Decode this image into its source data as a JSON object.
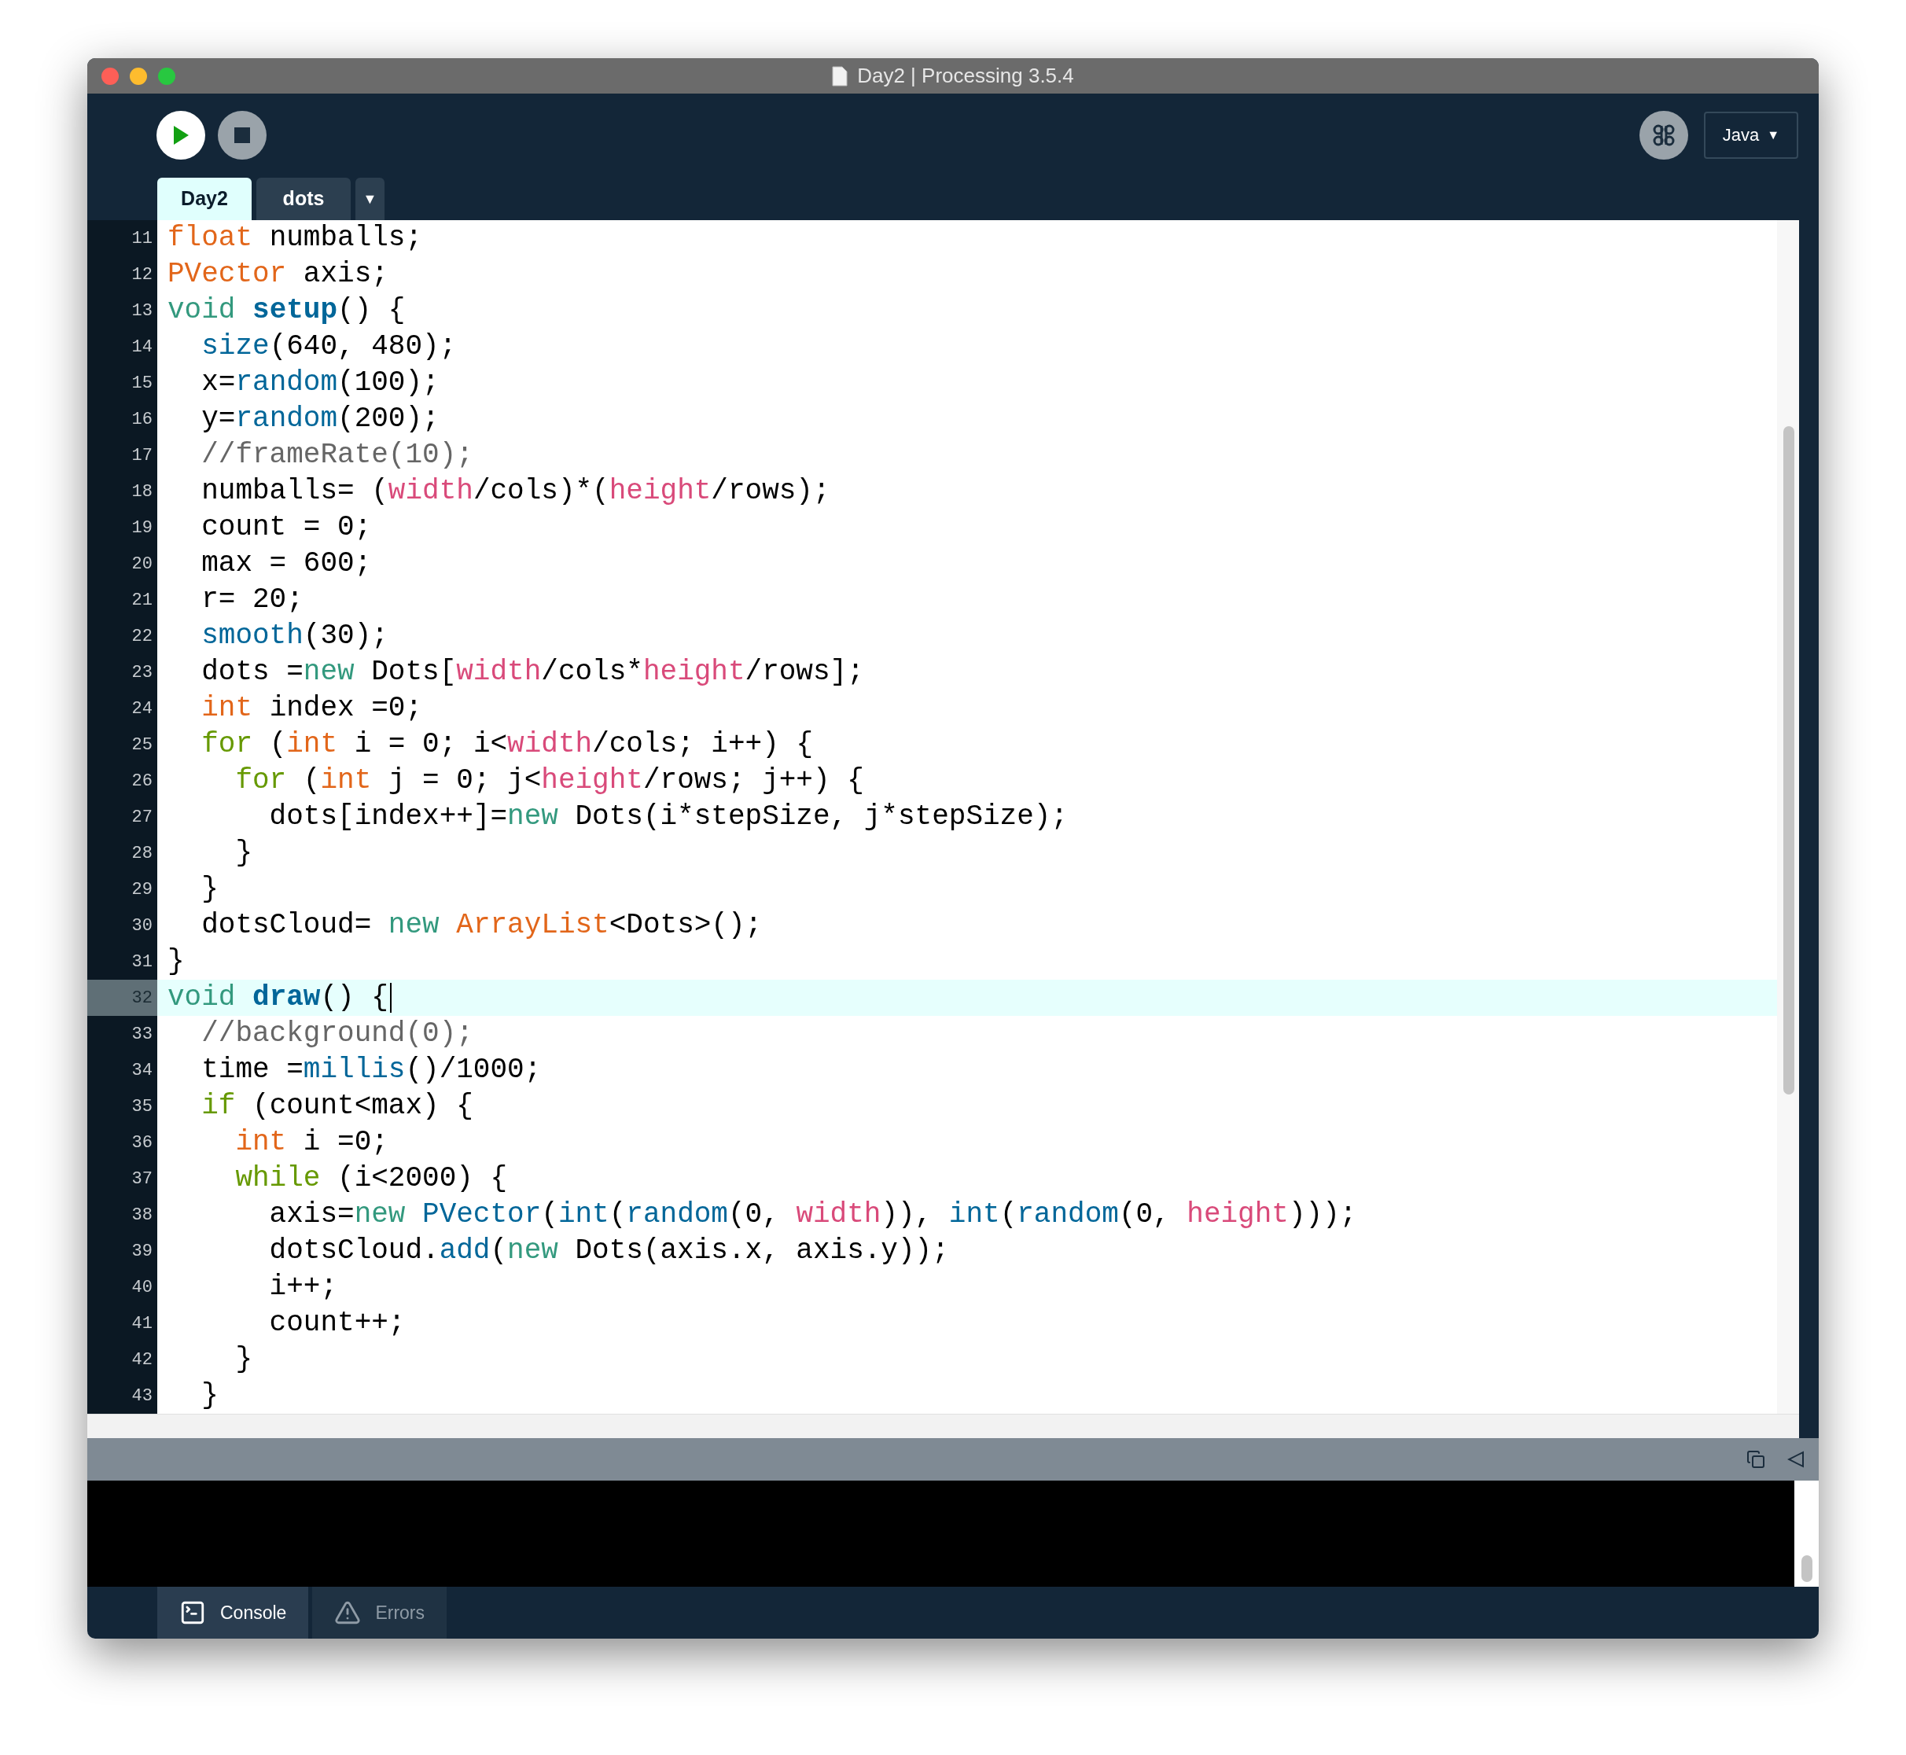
{
  "window": {
    "title": "Day2 | Processing 3.5.4"
  },
  "toolbar": {
    "mode": {
      "label": "Java",
      "caret": "▼"
    }
  },
  "tabs": [
    {
      "label": "Day2",
      "selected": true
    },
    {
      "label": "dots",
      "selected": false
    }
  ],
  "tab_menu": "▼",
  "editor": {
    "lines": [
      {
        "number": "11",
        "selected": false,
        "segments": [
          {
            "kind": "type",
            "text": "float"
          },
          {
            "kind": "plain",
            "text": " numballs;"
          }
        ]
      },
      {
        "number": "12",
        "selected": false,
        "segments": [
          {
            "kind": "type",
            "text": "PVector"
          },
          {
            "kind": "plain",
            "text": " axis;"
          }
        ]
      },
      {
        "number": "13",
        "selected": false,
        "segments": [
          {
            "kind": "keyword",
            "text": "void "
          },
          {
            "kind": "bold",
            "text": "setup"
          },
          {
            "kind": "plain",
            "text": "() {"
          }
        ]
      },
      {
        "number": "14",
        "selected": false,
        "segments": [
          {
            "kind": "function",
            "text": "  size"
          },
          {
            "kind": "plain",
            "text": "(640, 480);"
          }
        ]
      },
      {
        "number": "15",
        "selected": false,
        "segments": [
          {
            "kind": "plain",
            "text": "  x="
          },
          {
            "kind": "function",
            "text": "random"
          },
          {
            "kind": "plain",
            "text": "(100);"
          }
        ]
      },
      {
        "number": "16",
        "selected": false,
        "segments": [
          {
            "kind": "plain",
            "text": "  y="
          },
          {
            "kind": "function",
            "text": "random"
          },
          {
            "kind": "plain",
            "text": "(200);"
          }
        ]
      },
      {
        "number": "17",
        "selected": false,
        "segments": [
          {
            "kind": "comment",
            "text": "  //frameRate(10);"
          }
        ]
      },
      {
        "number": "18",
        "selected": false,
        "segments": [
          {
            "kind": "plain",
            "text": "  numballs= ("
          },
          {
            "kind": "constant",
            "text": "width"
          },
          {
            "kind": "plain",
            "text": "/cols)*("
          },
          {
            "kind": "constant",
            "text": "height"
          },
          {
            "kind": "plain",
            "text": "/rows);"
          }
        ]
      },
      {
        "number": "19",
        "selected": false,
        "segments": [
          {
            "kind": "plain",
            "text": "  count = 0;"
          }
        ]
      },
      {
        "number": "20",
        "selected": false,
        "segments": [
          {
            "kind": "plain",
            "text": "  max = 600;"
          }
        ]
      },
      {
        "number": "21",
        "selected": false,
        "segments": [
          {
            "kind": "plain",
            "text": "  r= 20;"
          }
        ]
      },
      {
        "number": "22",
        "selected": false,
        "segments": [
          {
            "kind": "function",
            "text": "  smooth"
          },
          {
            "kind": "plain",
            "text": "(30);"
          }
        ]
      },
      {
        "number": "23",
        "selected": false,
        "segments": [
          {
            "kind": "plain",
            "text": "  dots ="
          },
          {
            "kind": "keyword",
            "text": "new"
          },
          {
            "kind": "plain",
            "text": " Dots["
          },
          {
            "kind": "constant",
            "text": "width"
          },
          {
            "kind": "plain",
            "text": "/cols*"
          },
          {
            "kind": "constant",
            "text": "height"
          },
          {
            "kind": "plain",
            "text": "/rows];"
          }
        ]
      },
      {
        "number": "24",
        "selected": false,
        "segments": [
          {
            "kind": "type",
            "text": "  int"
          },
          {
            "kind": "plain",
            "text": " index =0;"
          }
        ]
      },
      {
        "number": "25",
        "selected": false,
        "segments": [
          {
            "kind": "control",
            "text": "  for"
          },
          {
            "kind": "plain",
            "text": " ("
          },
          {
            "kind": "type",
            "text": "int"
          },
          {
            "kind": "plain",
            "text": " i = 0; i<"
          },
          {
            "kind": "constant",
            "text": "width"
          },
          {
            "kind": "plain",
            "text": "/cols; i++) {"
          }
        ]
      },
      {
        "number": "26",
        "selected": false,
        "segments": [
          {
            "kind": "control",
            "text": "    for"
          },
          {
            "kind": "plain",
            "text": " ("
          },
          {
            "kind": "type",
            "text": "int"
          },
          {
            "kind": "plain",
            "text": " j = 0; j<"
          },
          {
            "kind": "constant",
            "text": "height"
          },
          {
            "kind": "plain",
            "text": "/rows; j++) {"
          }
        ]
      },
      {
        "number": "27",
        "selected": false,
        "segments": [
          {
            "kind": "plain",
            "text": "      dots[index++]="
          },
          {
            "kind": "keyword",
            "text": "new"
          },
          {
            "kind": "plain",
            "text": " Dots(i*stepSize, j*stepSize);"
          }
        ]
      },
      {
        "number": "28",
        "selected": false,
        "segments": [
          {
            "kind": "plain",
            "text": "    }"
          }
        ]
      },
      {
        "number": "29",
        "selected": false,
        "segments": [
          {
            "kind": "plain",
            "text": "  }"
          }
        ]
      },
      {
        "number": "30",
        "selected": false,
        "segments": [
          {
            "kind": "plain",
            "text": "  dotsCloud= "
          },
          {
            "kind": "keyword",
            "text": "new "
          },
          {
            "kind": "type",
            "text": "ArrayList"
          },
          {
            "kind": "plain",
            "text": "<Dots>();"
          }
        ]
      },
      {
        "number": "31",
        "selected": false,
        "segments": [
          {
            "kind": "plain",
            "text": "}"
          }
        ]
      },
      {
        "number": "32",
        "selected": true,
        "segments": [
          {
            "kind": "keyword",
            "text": "void "
          },
          {
            "kind": "bold",
            "text": "draw"
          },
          {
            "kind": "plain",
            "text": "() {"
          }
        ]
      },
      {
        "number": "33",
        "selected": false,
        "segments": [
          {
            "kind": "comment",
            "text": "  //background(0);"
          }
        ]
      },
      {
        "number": "34",
        "selected": false,
        "segments": [
          {
            "kind": "plain",
            "text": "  time ="
          },
          {
            "kind": "function",
            "text": "millis"
          },
          {
            "kind": "plain",
            "text": "()/1000;"
          }
        ]
      },
      {
        "number": "35",
        "selected": false,
        "segments": [
          {
            "kind": "control",
            "text": "  if"
          },
          {
            "kind": "plain",
            "text": " (count<max) {"
          }
        ]
      },
      {
        "number": "36",
        "selected": false,
        "segments": [
          {
            "kind": "type",
            "text": "    int"
          },
          {
            "kind": "plain",
            "text": " i =0;"
          }
        ]
      },
      {
        "number": "37",
        "selected": false,
        "segments": [
          {
            "kind": "control",
            "text": "    while"
          },
          {
            "kind": "plain",
            "text": " (i<2000) {"
          }
        ]
      },
      {
        "number": "38",
        "selected": false,
        "segments": [
          {
            "kind": "plain",
            "text": "      axis="
          },
          {
            "kind": "keyword",
            "text": "new "
          },
          {
            "kind": "function",
            "text": "PVector"
          },
          {
            "kind": "plain",
            "text": "("
          },
          {
            "kind": "function",
            "text": "int"
          },
          {
            "kind": "plain",
            "text": "("
          },
          {
            "kind": "function",
            "text": "random"
          },
          {
            "kind": "plain",
            "text": "(0, "
          },
          {
            "kind": "constant",
            "text": "width"
          },
          {
            "kind": "plain",
            "text": ")), "
          },
          {
            "kind": "function",
            "text": "int"
          },
          {
            "kind": "plain",
            "text": "("
          },
          {
            "kind": "function",
            "text": "random"
          },
          {
            "kind": "plain",
            "text": "(0, "
          },
          {
            "kind": "constant",
            "text": "height"
          },
          {
            "kind": "plain",
            "text": ")));"
          }
        ]
      },
      {
        "number": "39",
        "selected": false,
        "segments": [
          {
            "kind": "plain",
            "text": "      dotsCloud."
          },
          {
            "kind": "function",
            "text": "add"
          },
          {
            "kind": "plain",
            "text": "("
          },
          {
            "kind": "keyword",
            "text": "new"
          },
          {
            "kind": "plain",
            "text": " Dots(axis.x, axis.y));"
          }
        ]
      },
      {
        "number": "40",
        "selected": false,
        "segments": [
          {
            "kind": "plain",
            "text": "      i++;"
          }
        ]
      },
      {
        "number": "41",
        "selected": false,
        "segments": [
          {
            "kind": "plain",
            "text": "      count++;"
          }
        ]
      },
      {
        "number": "42",
        "selected": false,
        "segments": [
          {
            "kind": "plain",
            "text": "    }"
          }
        ]
      },
      {
        "number": "43",
        "selected": false,
        "segments": [
          {
            "kind": "plain",
            "text": "  }"
          }
        ]
      }
    ]
  },
  "bottom_tabs": [
    {
      "kind": "console",
      "label": "Console",
      "selected": true
    },
    {
      "kind": "errors",
      "label": "Errors",
      "selected": false
    }
  ]
}
